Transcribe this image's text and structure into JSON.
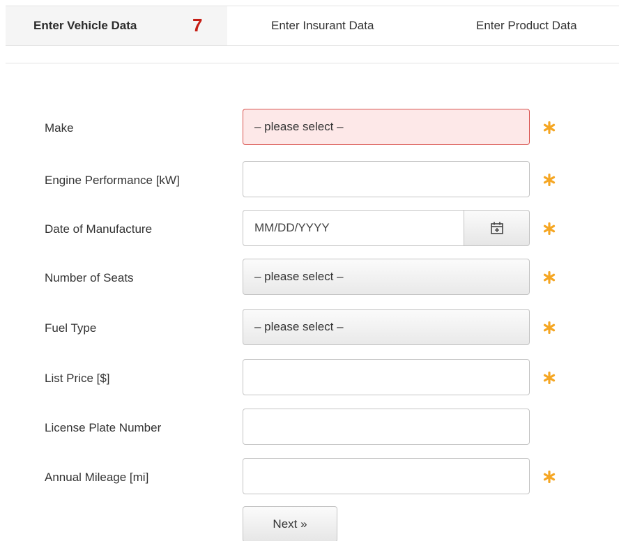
{
  "tabs": [
    {
      "label": "Enter Vehicle Data",
      "count": "7"
    },
    {
      "label": "Enter Insurant Data"
    },
    {
      "label": "Enter Product Data"
    }
  ],
  "form": {
    "make": {
      "label": "Make",
      "value": "– please select –"
    },
    "engine_performance": {
      "label": "Engine Performance [kW]",
      "value": ""
    },
    "date_of_manufacture": {
      "label": "Date of Manufacture",
      "placeholder": "MM/DD/YYYY"
    },
    "number_of_seats": {
      "label": "Number of Seats",
      "value": "– please select –"
    },
    "fuel_type": {
      "label": "Fuel Type",
      "value": "– please select –"
    },
    "list_price": {
      "label": "List Price [$]",
      "value": ""
    },
    "license_plate_number": {
      "label": "License Plate Number",
      "value": ""
    },
    "annual_mileage": {
      "label": "Annual Mileage [mi]",
      "value": ""
    }
  },
  "next_label": "Next »",
  "icons": {
    "required": "asterisk-icon",
    "calendar": "calendar-icon"
  },
  "colors": {
    "accent_red": "#c51d14",
    "required_orange": "#f5a623",
    "error_bg": "#fde8e8",
    "error_border": "#d9534f"
  }
}
